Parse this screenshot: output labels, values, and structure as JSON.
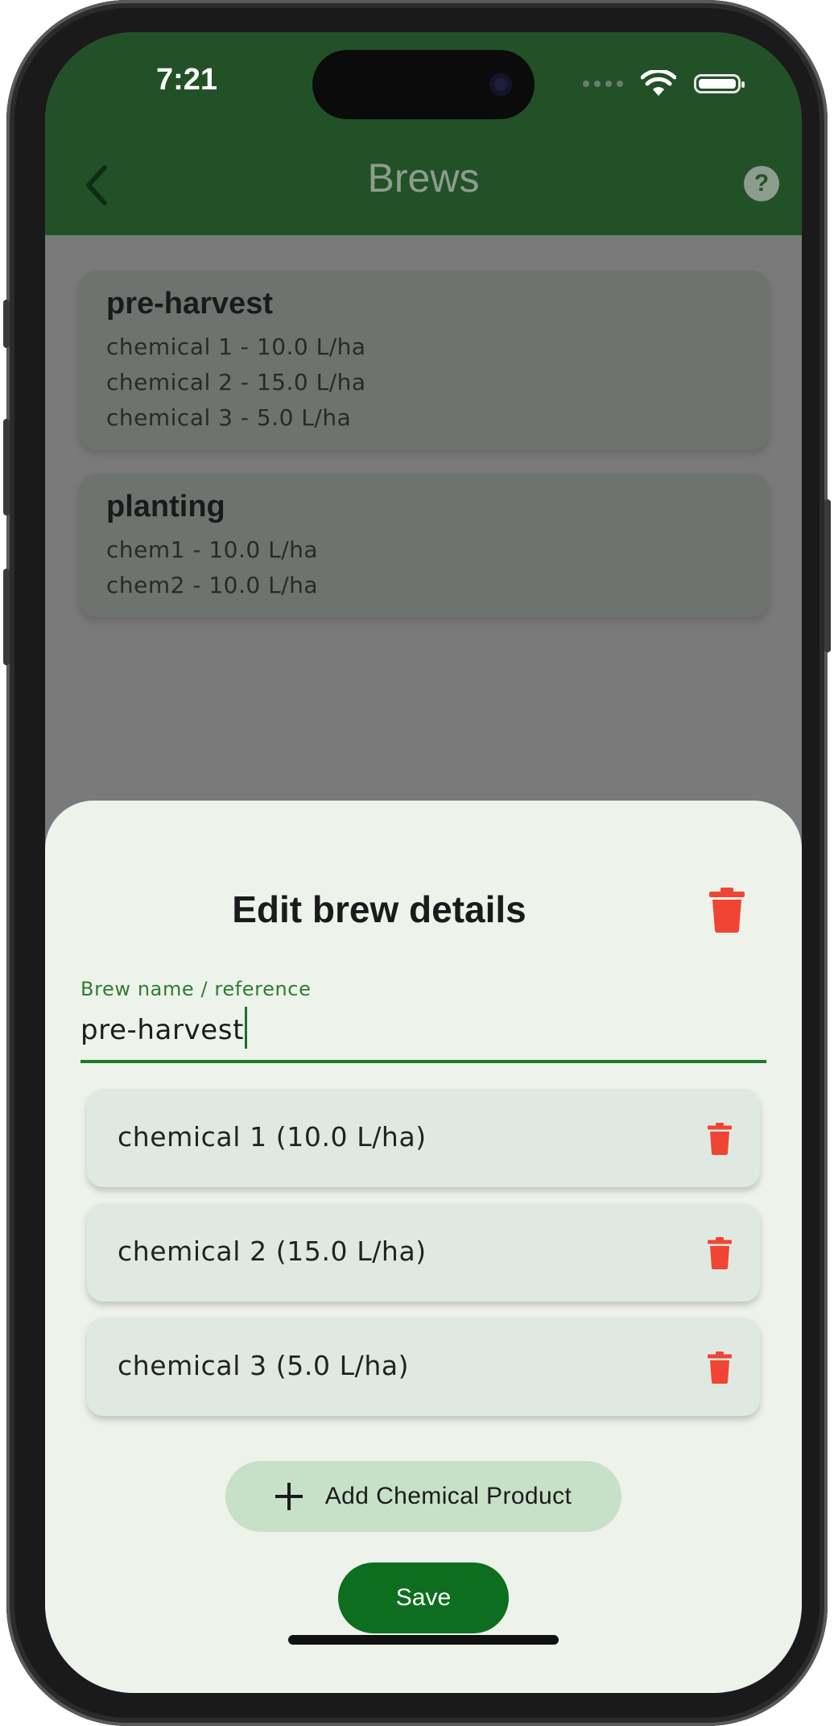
{
  "status_bar": {
    "time": "7:21"
  },
  "header": {
    "title": "Brews",
    "help_glyph": "?"
  },
  "brew_list": [
    {
      "name": "pre-harvest",
      "lines": [
        "chemical 1 - 10.0 L/ha",
        "chemical 2 - 15.0 L/ha",
        "chemical 3 - 5.0 L/ha"
      ]
    },
    {
      "name": "planting",
      "lines": [
        "chem1 - 10.0 L/ha",
        "chem2 - 10.0 L/ha"
      ]
    }
  ],
  "sheet": {
    "title": "Edit brew details",
    "field_label": "Brew name / reference",
    "field_value": "pre-harvest",
    "chemicals": [
      {
        "label": "chemical 1 (10.0 L/ha)"
      },
      {
        "label": "chemical 2 (15.0 L/ha)"
      },
      {
        "label": "chemical 3 (5.0 L/ha)"
      }
    ],
    "add_label": "Add Chemical Product",
    "save_label": "Save"
  },
  "colors": {
    "header_bg": "#235127",
    "accent": "#0d6e1f",
    "delete": "#f04435",
    "sheet_bg": "#edf2ea"
  }
}
